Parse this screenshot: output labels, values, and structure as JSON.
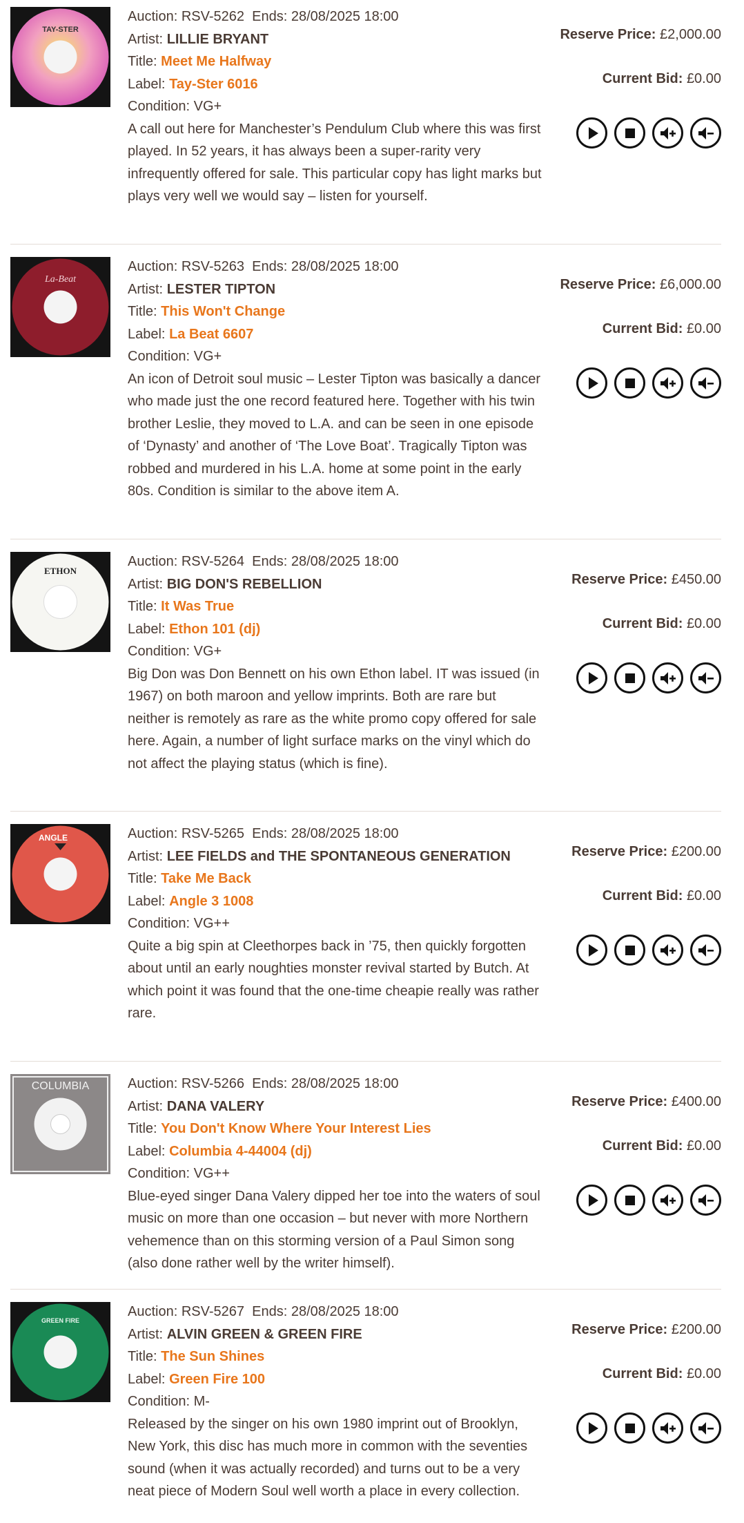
{
  "labels": {
    "auction": "Auction:",
    "ends": "Ends:",
    "artist": "Artist:",
    "title": "Title:",
    "label": "Label:",
    "condition": "Condition:",
    "reserve": "Reserve Price:",
    "current_bid": "Current Bid:"
  },
  "controls": [
    "play-icon",
    "stop-icon",
    "volume-up-icon",
    "volume-down-icon"
  ],
  "colors": {
    "accent": "#e8761b",
    "text": "#4a3b34",
    "divider": "#e4dcd6"
  },
  "items": [
    {
      "auction": "RSV-5262",
      "ends": "28/08/2025 18:00",
      "artist": "LILLIE BRYANT",
      "title": "Meet Me Halfway",
      "label": "Tay-Ster 6016",
      "condition": "VG+",
      "reserve": "£2,000.00",
      "current_bid": "£0.00",
      "record_text": "TAY-STER",
      "description": "A call out here for Manchester’s Pendulum Club where this was first played. In 52 years, it has always been a super-rarity very infrequently offered for sale. This particular copy has light marks but plays very well we would say – listen for yourself."
    },
    {
      "auction": "RSV-5263",
      "ends": "28/08/2025 18:00",
      "artist": "LESTER TIPTON",
      "title": "This Won't Change",
      "label": "La Beat 6607",
      "condition": "VG+",
      "reserve": "£6,000.00",
      "current_bid": "£0.00",
      "record_text": "La-Beat",
      "description": "An icon of Detroit soul music – Lester Tipton was basically a dancer who made just the one record featured here. Together with his twin brother Leslie, they moved to L.A. and can be seen in one episode of ‘Dynasty’ and another of ‘The Love Boat’. Tragically Tipton was robbed and murdered in his L.A. home at some point in the early 80s. Condition is similar to the above item A."
    },
    {
      "auction": "RSV-5264",
      "ends": "28/08/2025 18:00",
      "artist": "BIG DON'S REBELLION",
      "title": "It Was True",
      "label": "Ethon 101 (dj)",
      "condition": "VG+",
      "reserve": "£450.00",
      "current_bid": "£0.00",
      "record_text": "ETHON",
      "description": "Big Don was Don Bennett on his own Ethon label. IT was issued (in 1967) on both maroon and yellow imprints. Both are rare but neither is remotely as rare as the white promo copy offered for sale here. Again, a number of light surface marks on the vinyl which do not affect the playing status (which is fine)."
    },
    {
      "auction": "RSV-5265",
      "ends": "28/08/2025 18:00",
      "artist": "LEE FIELDS and THE SPONTANEOUS GENERATION",
      "title": "Take Me Back",
      "label": "Angle 3 1008",
      "condition": "VG++",
      "reserve": "£200.00",
      "current_bid": "£0.00",
      "record_text": "ANGLE",
      "description": "Quite a big spin at Cleethorpes back in ’75, then quickly forgotten about until an early noughties monster revival started by Butch. At which point it was found that the one-time cheapie really was rather rare."
    },
    {
      "auction": "RSV-5266",
      "ends": "28/08/2025 18:00",
      "artist": "DANA VALERY",
      "title": "You Don't Know Where Your Interest Lies",
      "label": "Columbia 4-44004 (dj)",
      "condition": "VG++",
      "reserve": "£400.00",
      "current_bid": "£0.00",
      "record_text": "COLUMBIA",
      "description": "Blue-eyed singer Dana Valery dipped her toe into the waters of soul music on more than one occasion – but never with more Northern vehemence than on this storming version of a Paul Simon song (also done rather well by the writer himself)."
    },
    {
      "auction": "RSV-5267",
      "ends": "28/08/2025 18:00",
      "artist": "ALVIN GREEN & GREEN FIRE",
      "title": "The Sun Shines",
      "label": "Green Fire 100",
      "condition": "M-",
      "reserve": "£200.00",
      "current_bid": "£0.00",
      "record_text": "GREEN FIRE",
      "description": "Released by the singer on his own 1980 imprint out of Brooklyn, New York, this disc has much more in common with the seventies sound (when it was actually recorded) and turns out to be a very neat piece of Modern Soul well worth a place in every collection."
    }
  ]
}
